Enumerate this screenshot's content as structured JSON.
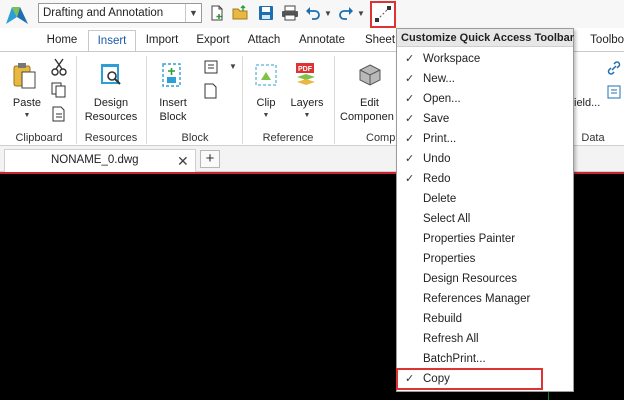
{
  "qat": {
    "workspace": "Drafting and Annotation",
    "icons": [
      "app-logo-icon",
      "new-file-icon",
      "open-folder-icon",
      "save-icon",
      "print-icon",
      "undo-icon",
      "redo-icon",
      "customize-toolbar-icon"
    ]
  },
  "tabs": [
    "Home",
    "Insert",
    "Import",
    "Export",
    "Attach",
    "Annotate",
    "Sheet",
    "Toolbox"
  ],
  "active_tab": "Insert",
  "ribbon": {
    "clipboard": {
      "paste": "Paste",
      "label": "Clipboard"
    },
    "resources": {
      "design_resources_1": "Design",
      "design_resources_2": "Resources",
      "label": "Resources"
    },
    "block": {
      "insert_block_1": "Insert",
      "insert_block_2": "Block",
      "label": "Block"
    },
    "reference": {
      "clip": "Clip",
      "layers": "Layers",
      "label": "Reference"
    },
    "component": {
      "edit_1": "Edit",
      "edit_2": "Componen",
      "label": "Comp"
    },
    "data": {
      "field": "ield...",
      "label": "Data"
    }
  },
  "document": {
    "tab_label": "NONAME_0.dwg",
    "close": "✕",
    "new_tab": "+"
  },
  "menu": {
    "title": "Customize Quick Access Toolbar",
    "items": [
      {
        "label": "Workspace",
        "checked": "✓"
      },
      {
        "label": "New...",
        "checked": "✓"
      },
      {
        "label": "Open...",
        "checked": "✓"
      },
      {
        "label": "Save",
        "checked": "✓"
      },
      {
        "label": "Print...",
        "checked": "✓"
      },
      {
        "label": "Undo",
        "checked": "✓"
      },
      {
        "label": "Redo",
        "checked": "✓"
      },
      {
        "label": "Delete",
        "checked": ""
      },
      {
        "label": "Select All",
        "checked": ""
      },
      {
        "label": "Properties Painter",
        "checked": ""
      },
      {
        "label": "Properties",
        "checked": ""
      },
      {
        "label": "Design Resources",
        "checked": ""
      },
      {
        "label": "References Manager",
        "checked": ""
      },
      {
        "label": "Rebuild",
        "checked": ""
      },
      {
        "label": "Refresh All",
        "checked": ""
      },
      {
        "label": "BatchPrint...",
        "checked": ""
      },
      {
        "label": "Copy",
        "checked": "✓"
      }
    ]
  },
  "colors": {
    "accent": "#1a5aa8",
    "highlight_box": "#d33333",
    "canvas": "#000000",
    "axis": "#0a8a2a"
  }
}
